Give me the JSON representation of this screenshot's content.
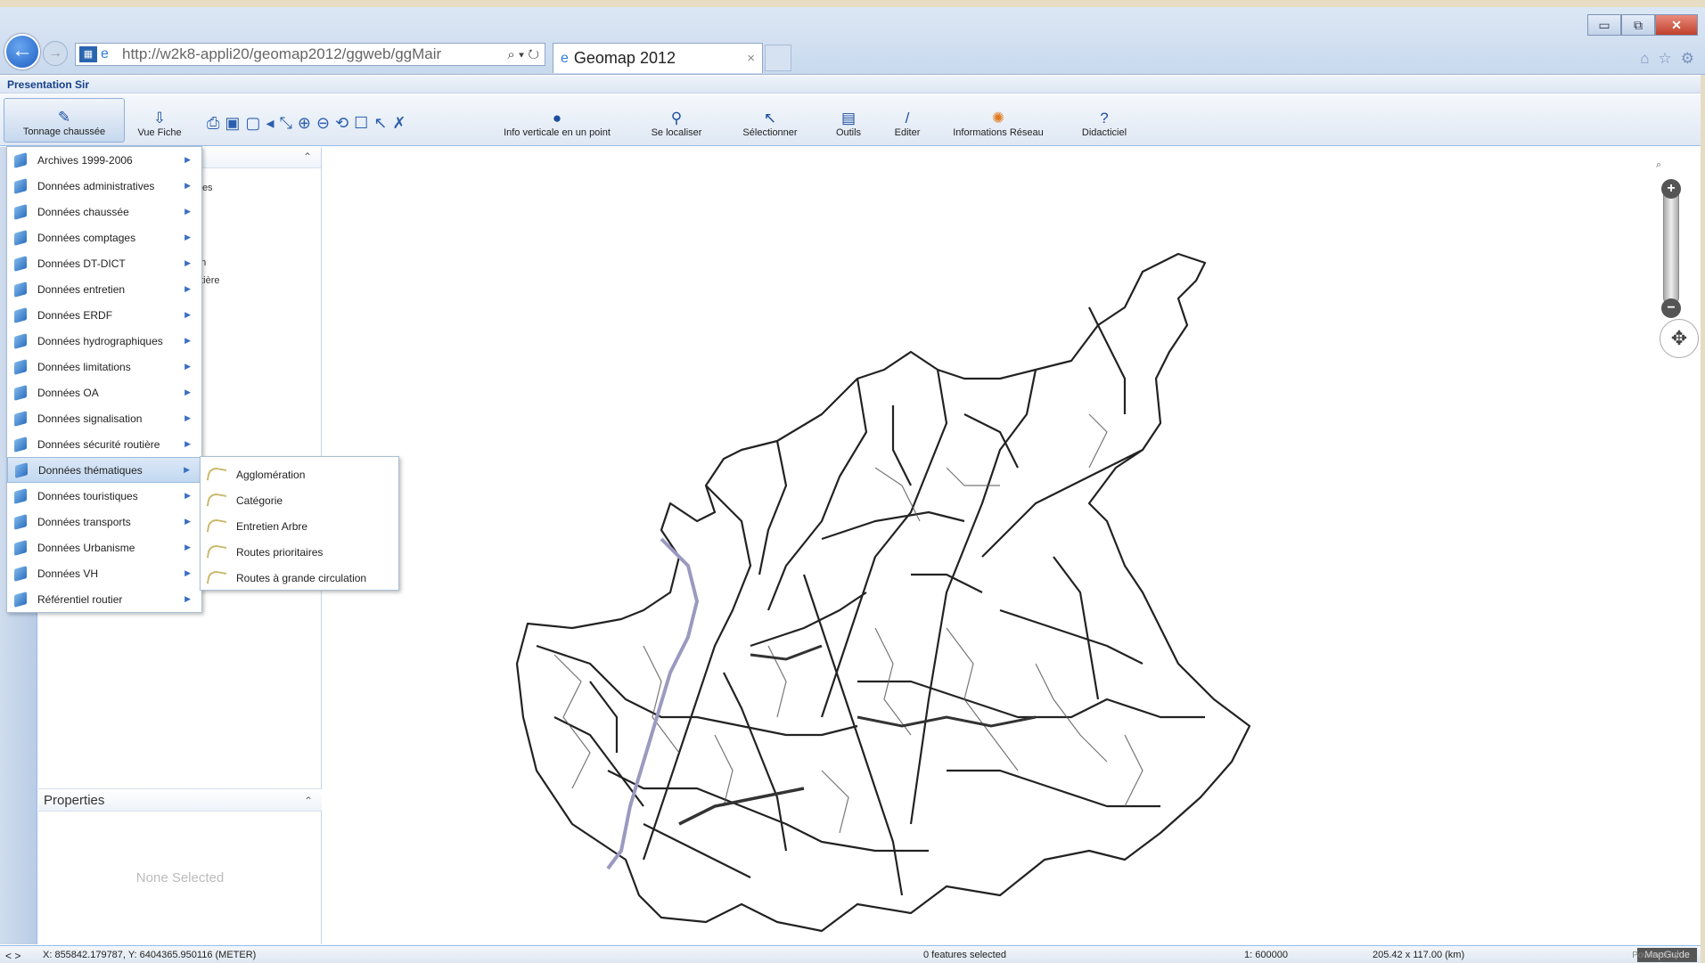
{
  "browser": {
    "url": "http://w2k8-appli20/geomap2012/ggweb/ggMair",
    "address_tools": "⌕ ▾ ↻",
    "tab_title": "Geomap 2012",
    "tab_close": "×",
    "window_buttons": {
      "minimize": "▭",
      "restore": "⧉",
      "close": "✕"
    },
    "right_icons": [
      "⌂",
      "☆",
      "⚙"
    ]
  },
  "app": {
    "title": "Presentation Sir"
  },
  "toolbar": {
    "tonnage_label": "Tonnage chaussée",
    "vue_fiche_label": "Vue Fiche",
    "info_verticale_label": "Info verticale en un point",
    "se_localiser_label": "Se localiser",
    "selectionner_label": "Sélectionner",
    "outils_label": "Outils",
    "editer_label": "Editer",
    "informations_reseau_label": "Informations Réseau",
    "didacticiel_label": "Didacticiel"
  },
  "menu": {
    "items": [
      "Archives 1999-2006",
      "Données administratives",
      "Données chaussée",
      "Données comptages",
      "Données DT-DICT",
      "Données entretien",
      "Données ERDF",
      "Données hydrographiques",
      "Données limitations",
      "Données OA",
      "Données signalisation",
      "Données sécurité routière",
      "Données thématiques",
      "Données touristiques",
      "Données transports",
      "Données Urbanisme",
      "Données VH",
      "Référentiel routier"
    ],
    "highlighted_index": 12
  },
  "submenu": {
    "items": [
      "Agglomération",
      "Catégorie",
      "Entretien Arbre",
      "Routes prioritaires",
      "Routes à grande circulation"
    ]
  },
  "legend_stub": [
    "ives",
    "s",
    "on",
    "utière"
  ],
  "properties": {
    "title": "Properties",
    "empty_text": "None Selected"
  },
  "status": {
    "coordinates": "X: 855842.179787, Y: 6404365.950116 (METER)",
    "selection": "0 features selected",
    "scale": "1: 600000",
    "extent": "205.42 x 117.00 (km)",
    "powered_by": "Powered by",
    "brand": "MapGuide",
    "nav": "< >"
  },
  "colors": {
    "accent": "#15428b",
    "highlight": "#c2d8f1",
    "highway": "#9a9ac0"
  }
}
